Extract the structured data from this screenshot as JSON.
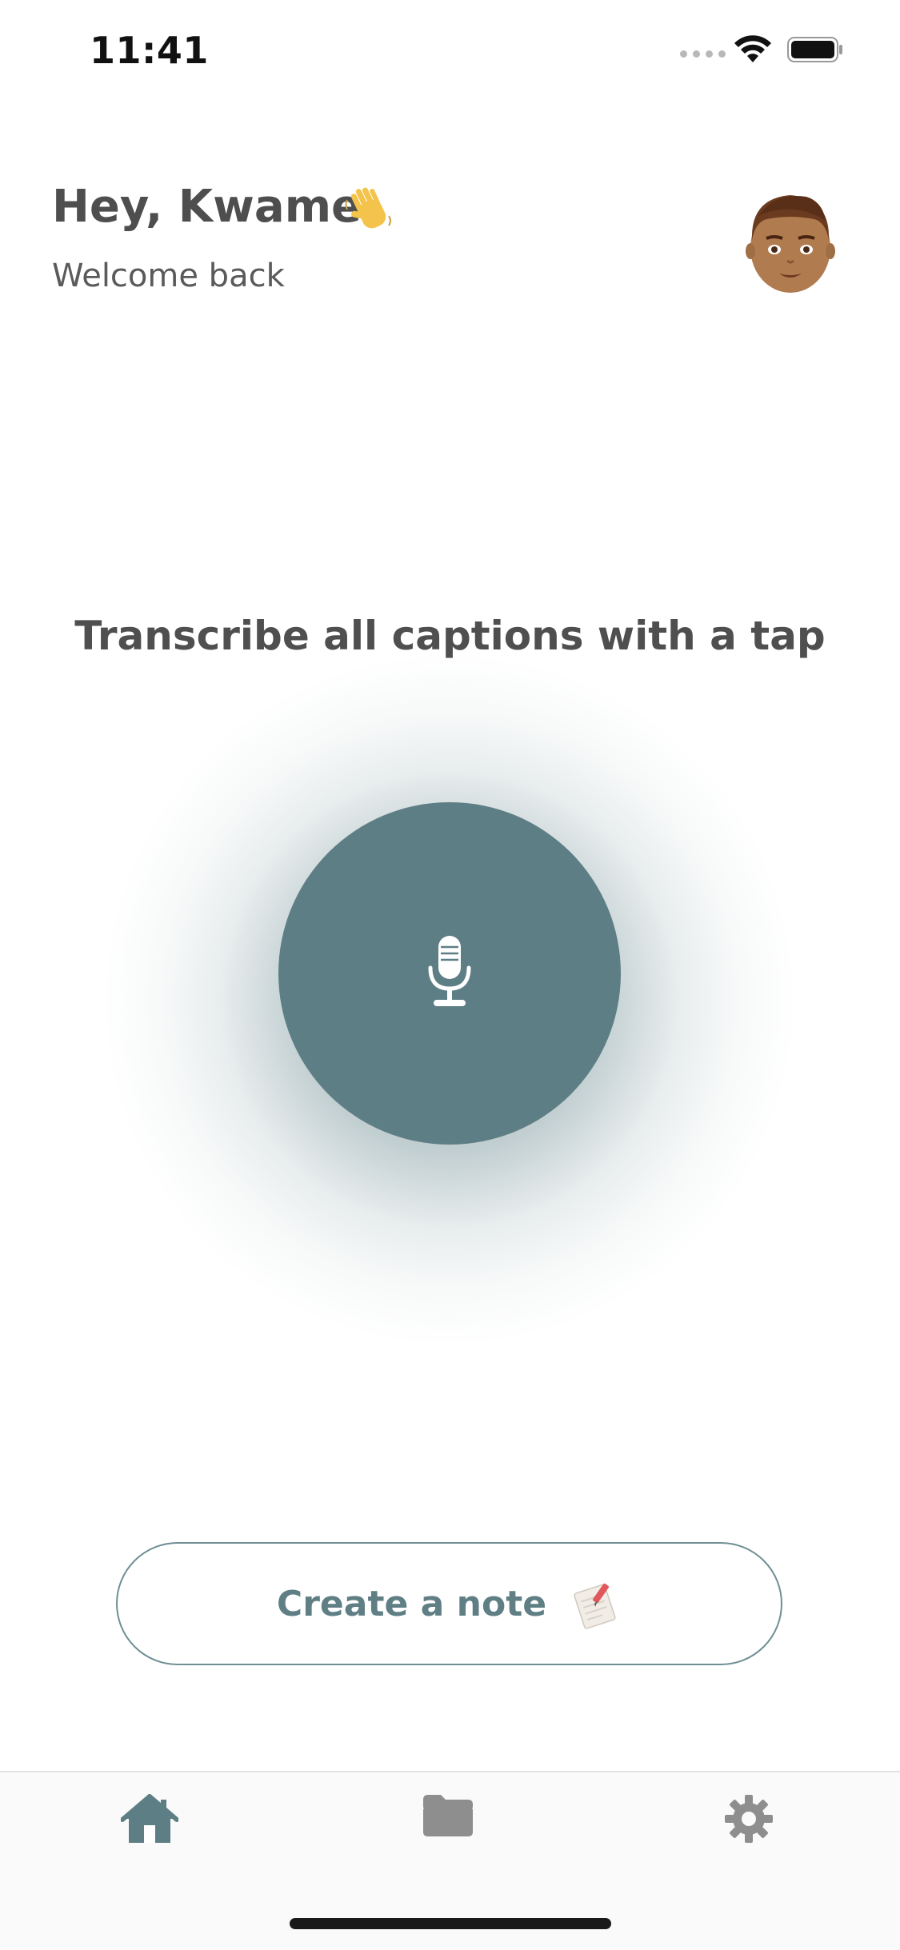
{
  "status_bar": {
    "time": "11:41"
  },
  "header": {
    "greeting": "Hey, Kwame",
    "greeting_emoji": "waving-hand",
    "subtitle": "Welcome back",
    "avatar": "man-emoji-avatar"
  },
  "main": {
    "headline": "Transcribe all captions with a tap",
    "record_button_icon": "microphone-icon"
  },
  "create_note": {
    "label": "Create a note",
    "icon": "memo-pencil-icon"
  },
  "tab_bar": {
    "tabs": [
      {
        "id": "home",
        "icon": "home-icon",
        "active": true
      },
      {
        "id": "files",
        "icon": "folder-icon",
        "active": false
      },
      {
        "id": "settings",
        "icon": "gear-icon",
        "active": false
      }
    ]
  },
  "colors": {
    "accent": "#5d7e84",
    "text_primary": "#4e4e4e",
    "tab_inactive": "#8e8e8e"
  }
}
